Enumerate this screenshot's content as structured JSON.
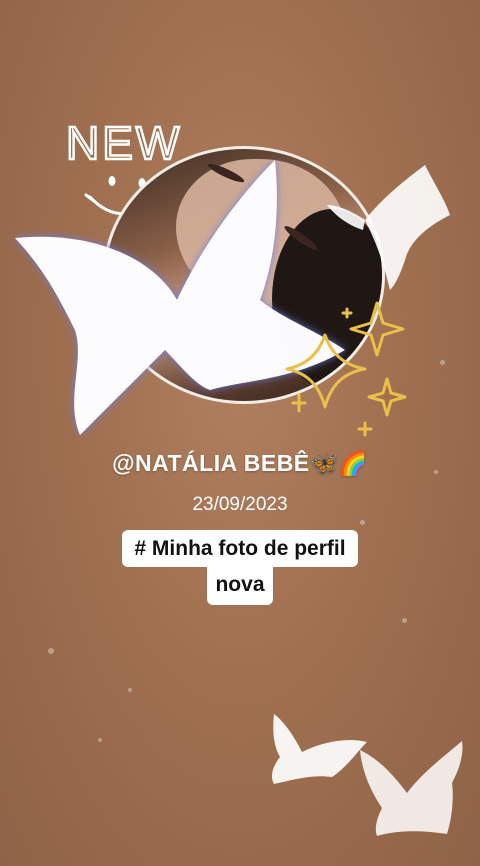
{
  "story": {
    "sticker": {
      "new_label": "NEW"
    },
    "profile": {
      "username": "@NATÁLIA BEBÊ",
      "username_emojis": "🦋🌈",
      "date": "23/09/2023"
    },
    "caption": {
      "line1": "# Minha foto de perfil",
      "line2": "nova"
    }
  },
  "colors": {
    "background": "#a07050",
    "ring": "#f4ede6",
    "butterfly_fill": "#ffffff",
    "butterfly_glow": "#6b7be8",
    "sparkle": "#e8c04a",
    "caption_bg": "#ffffff",
    "caption_text": "#111111"
  },
  "icons": [
    "smiley-doodle",
    "butterfly",
    "sparkle",
    "butterfly-emoji",
    "rainbow-emoji"
  ]
}
